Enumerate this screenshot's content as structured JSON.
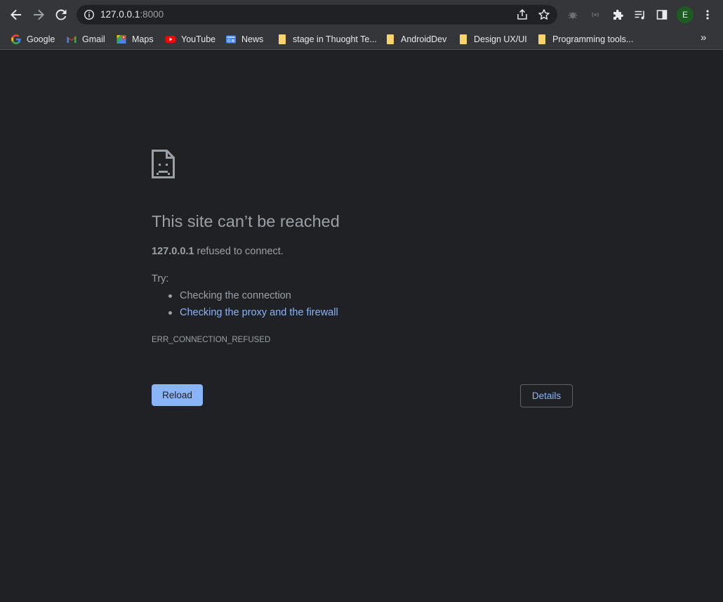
{
  "toolbar": {
    "back_icon": "arrow-left-icon",
    "forward_icon": "arrow-right-icon",
    "reload_icon": "reload-icon",
    "url_host": "127.0.0.1",
    "url_port": ":8000",
    "profile_initial": "E"
  },
  "bookmarks": [
    {
      "label": "Google",
      "icon": "google-icon"
    },
    {
      "label": "Gmail",
      "icon": "gmail-icon"
    },
    {
      "label": "Maps",
      "icon": "maps-icon"
    },
    {
      "label": "YouTube",
      "icon": "youtube-icon"
    },
    {
      "label": "News",
      "icon": "news-icon"
    },
    {
      "label": "stage in Thuoght Te...",
      "icon": "folder-icon"
    },
    {
      "label": "AndroidDev",
      "icon": "folder-icon"
    },
    {
      "label": "Design UX/UI",
      "icon": "folder-icon"
    },
    {
      "label": "Programming tools...",
      "icon": "folder-icon"
    }
  ],
  "bookmarks_more": "»",
  "error": {
    "title": "This site can’t be reached",
    "host": "127.0.0.1",
    "message": " refused to connect.",
    "try_label": "Try:",
    "suggestions": [
      "Checking the connection",
      "Checking the proxy and the firewall"
    ],
    "code": "ERR_CONNECTION_REFUSED",
    "reload_label": "Reload",
    "details_label": "Details"
  },
  "colors": {
    "background": "#202124",
    "toolbar": "#35363a",
    "link": "#8ab4f8",
    "button": "#8ab4f8"
  }
}
